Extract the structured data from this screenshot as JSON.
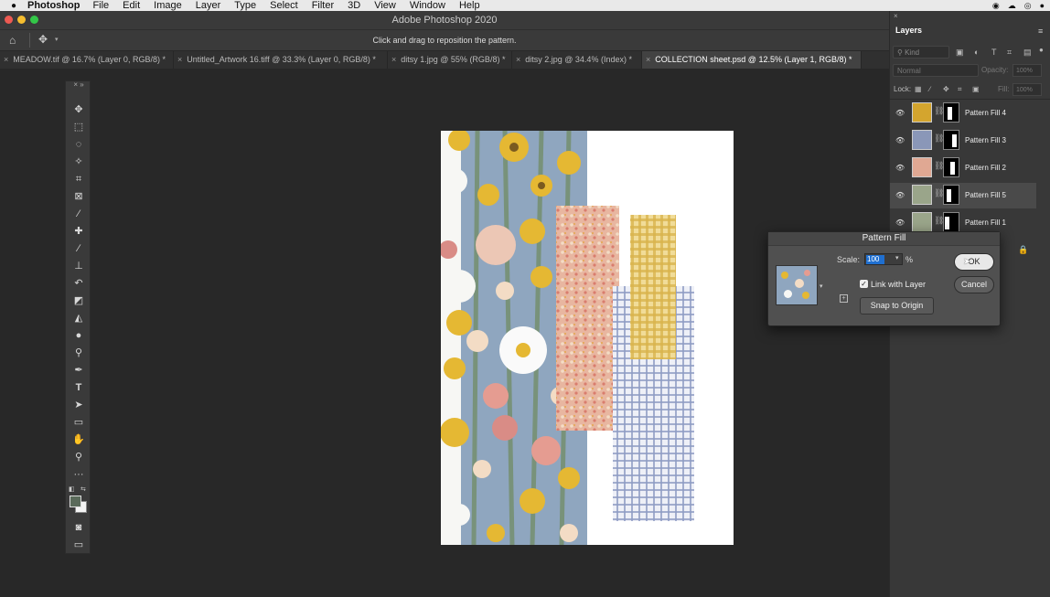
{
  "menubar": {
    "app": "Photoshop",
    "items": [
      "File",
      "Edit",
      "Image",
      "Layer",
      "Type",
      "Select",
      "Filter",
      "3D",
      "View",
      "Window",
      "Help"
    ]
  },
  "window": {
    "title": "Adobe Photoshop 2020"
  },
  "optionsbar": {
    "hint": "Click and drag to reposition the pattern."
  },
  "tabs": [
    {
      "label": "MEADOW.tif @ 16.7% (Layer 0, RGB/8) *",
      "active": false
    },
    {
      "label": "Untitled_Artwork 16.tiff @ 33.3% (Layer 0, RGB/8) *",
      "active": false
    },
    {
      "label": "ditsy 1.jpg @ 55% (RGB/8) *",
      "active": false
    },
    {
      "label": "ditsy 2.jpg @ 34.4% (Index) *",
      "active": false
    },
    {
      "label": "COLLECTION sheet.psd @ 12.5% (Layer 1, RGB/8) *",
      "active": true
    }
  ],
  "layers_panel": {
    "title": "Layers",
    "search_placeholder": "Kind",
    "blend_mode": "Normal",
    "opacity_label": "Opacity:",
    "opacity_value": "100%",
    "lock_label": "Lock:",
    "fill_label": "Fill:",
    "fill_value": "100%",
    "layers": [
      {
        "name": "Pattern Fill 4",
        "selected": false,
        "thumb_color": "#d4a52e"
      },
      {
        "name": "Pattern Fill 3",
        "selected": false,
        "thumb_color": "#8a97b8"
      },
      {
        "name": "Pattern Fill 2",
        "selected": false,
        "thumb_color": "#e0a893"
      },
      {
        "name": "Pattern Fill 5",
        "selected": true,
        "thumb_color": "#9aa58a"
      },
      {
        "name": "Pattern Fill 1",
        "selected": false,
        "thumb_color": "#9aa58a"
      }
    ]
  },
  "dialog": {
    "title": "Pattern Fill",
    "scale_label": "Scale:",
    "scale_value": "100",
    "scale_unit": "%",
    "link_label": "Link with Layer",
    "link_checked": true,
    "snap_label": "Snap to Origin",
    "ok_label": "OK",
    "cancel_label": "Cancel"
  },
  "colors": {
    "accent": "#1f6fd0",
    "floral_bg": "#8fa6bf",
    "pink_strip": "#e8b6a0",
    "yellow_gingham": "#d8b24a",
    "blue_gingham": "#8e9cc4"
  }
}
